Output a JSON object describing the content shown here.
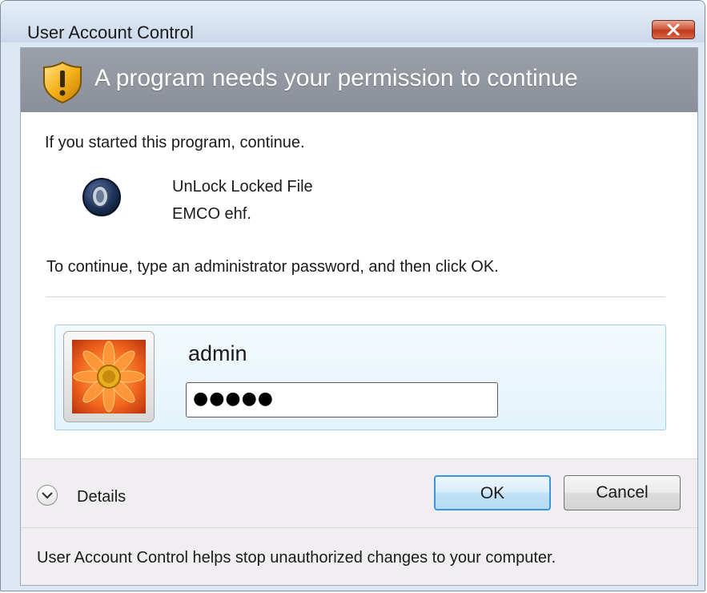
{
  "window": {
    "title": "User Account Control"
  },
  "banner": {
    "heading": "A program needs your permission to continue",
    "icon": "shield-warning-icon"
  },
  "body": {
    "started_text": "If you started this program, continue.",
    "program": {
      "name": "UnLock Locked File",
      "publisher": "EMCO ehf.",
      "icon": "program-icon"
    },
    "instruction": "To continue, type an administrator password, and then click OK."
  },
  "credentials": {
    "username": "admin",
    "password_mask": "●●●●●",
    "avatar": "flower-avatar"
  },
  "footer": {
    "details_label": "Details",
    "ok_label": "OK",
    "cancel_label": "Cancel"
  },
  "status": {
    "text": "User Account Control helps stop unauthorized changes to your computer."
  },
  "colors": {
    "banner": "#8a8f99",
    "ok_border": "#3d95d9",
    "close_button": "#c0391c",
    "credential_tile": "#e3f3fb"
  }
}
